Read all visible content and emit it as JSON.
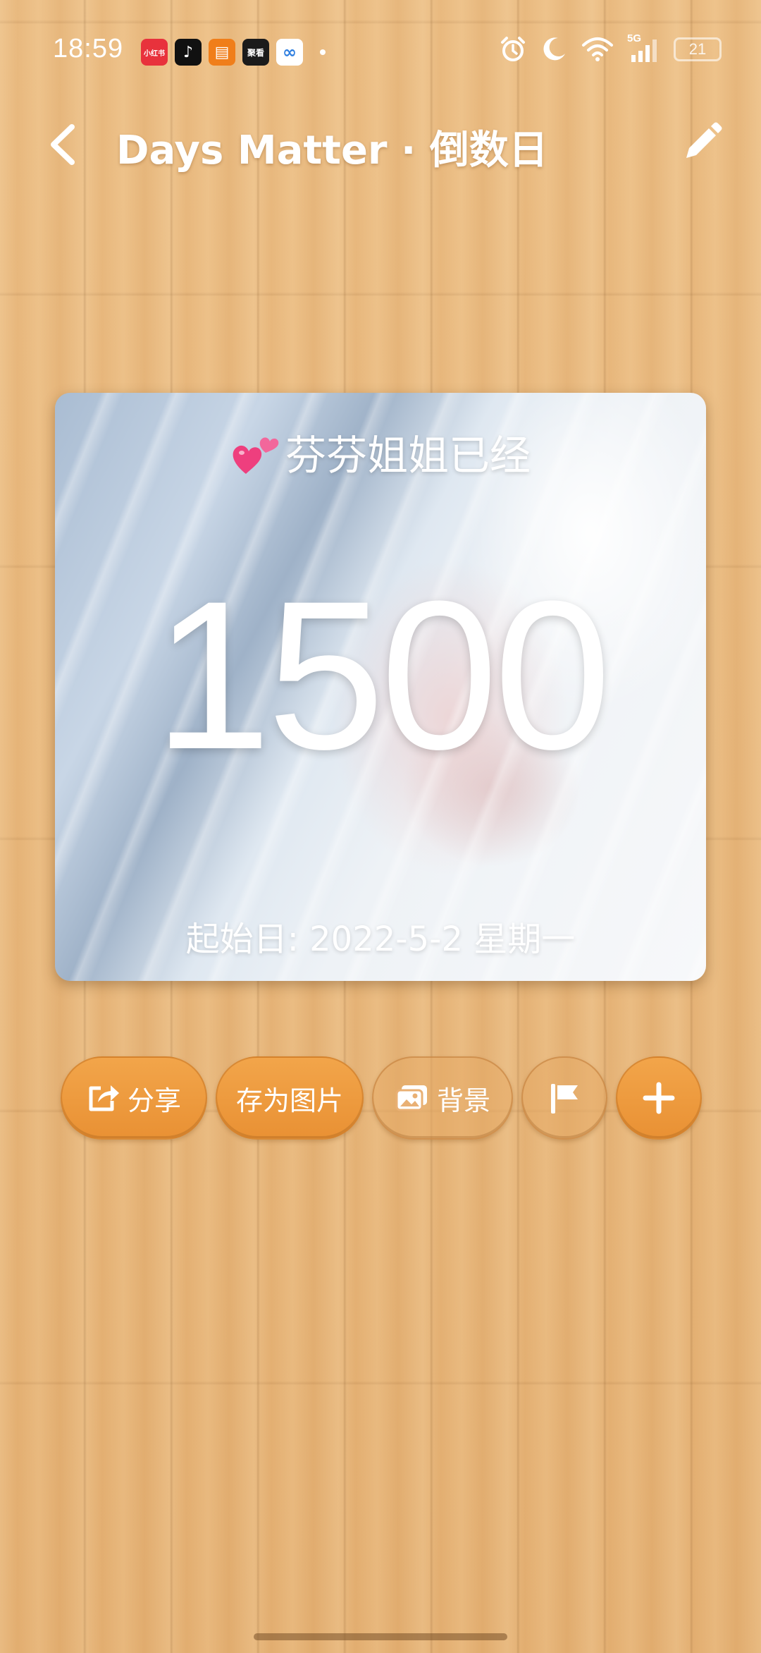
{
  "status_bar": {
    "time": "18:59",
    "app_icons": [
      {
        "name": "xiaohongshu-app-icon",
        "label": "小红书",
        "color": "#e8323c"
      },
      {
        "name": "tiktok-app-icon",
        "label": "♪",
        "color": "#111111"
      },
      {
        "name": "reader-app-icon",
        "label": "▤",
        "color": "#f07e1a"
      },
      {
        "name": "news-app-icon",
        "label": "聚看",
        "color": "#1b1b1b"
      },
      {
        "name": "cloud-app-icon",
        "label": "∞",
        "color": "#ffffff"
      }
    ],
    "network": "5G",
    "battery": "21"
  },
  "header": {
    "title": "Days Matter · 倒数日"
  },
  "card": {
    "title": "芬芬姐姐已经",
    "day_count": "1500",
    "start_date": "起始日: 2022-5-2 星期一"
  },
  "actions": {
    "share_label": "分享",
    "save_image_label": "存为图片",
    "background_label": "背景"
  },
  "colors": {
    "wood": "#e7b77c",
    "button_orange": "#ee9d40",
    "heart_pink": "#ee3f7e"
  }
}
